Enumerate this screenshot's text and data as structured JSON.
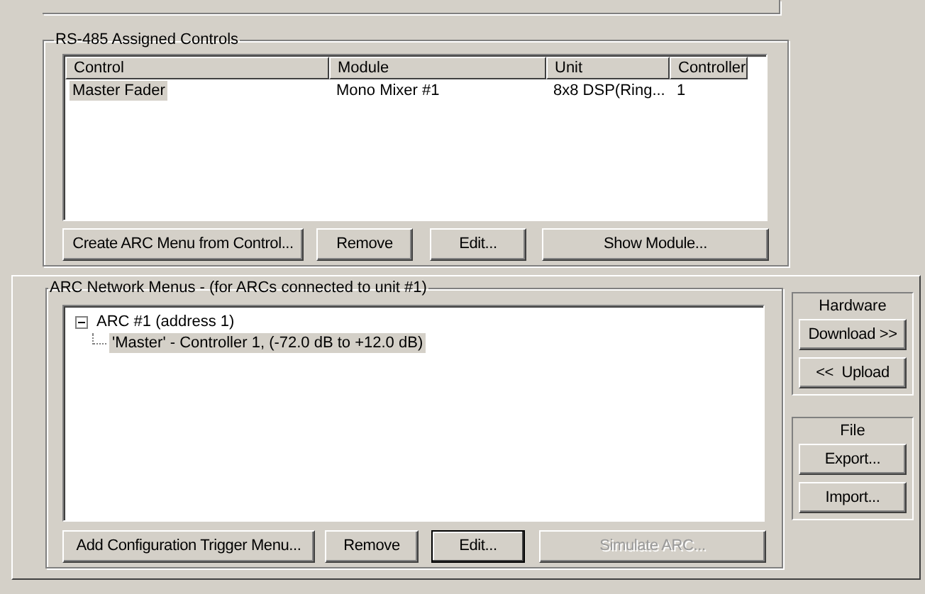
{
  "assigned_controls": {
    "title": "RS-485 Assigned Controls",
    "columns": [
      "Control",
      "Module",
      "Unit",
      "Controller"
    ],
    "rows": [
      {
        "cells": [
          "Master Fader",
          "Mono Mixer #1",
          "8x8 DSP(Ring...",
          "1"
        ],
        "selected": true
      }
    ],
    "buttons": [
      {
        "label": "Create ARC Menu from Control...",
        "disabled": false,
        "focused": false
      },
      {
        "label": "Remove",
        "disabled": false,
        "focused": false
      },
      {
        "label": "Edit...",
        "disabled": false,
        "focused": false
      },
      {
        "label": "Show Module...",
        "disabled": false,
        "focused": false
      }
    ]
  },
  "arc_menus": {
    "title": "ARC Network Menus - (for ARCs connected to unit #1)",
    "tree": [
      {
        "label": "ARC #1 (address 1)",
        "expanded": true,
        "selected": false,
        "children": [
          {
            "label": "'Master' - Controller 1, (-72.0 dB to +12.0 dB)",
            "selected": true
          }
        ]
      }
    ],
    "buttons": [
      {
        "label": "Add Configuration Trigger Menu...",
        "disabled": false,
        "focused": false
      },
      {
        "label": "Remove",
        "disabled": false,
        "focused": false
      },
      {
        "label": "Edit...",
        "disabled": false,
        "focused": true
      },
      {
        "label": "Simulate ARC...",
        "disabled": true,
        "focused": false
      }
    ]
  },
  "hardware": {
    "title": "Hardware",
    "buttons": [
      {
        "label": "Download >>",
        "disabled": false,
        "focused": false
      },
      {
        "label": "<<  Upload",
        "disabled": false,
        "focused": false
      }
    ]
  },
  "file": {
    "title": "File",
    "buttons": [
      {
        "label": "Export...",
        "disabled": false,
        "focused": false
      },
      {
        "label": "Import...",
        "disabled": false,
        "focused": false
      }
    ]
  }
}
